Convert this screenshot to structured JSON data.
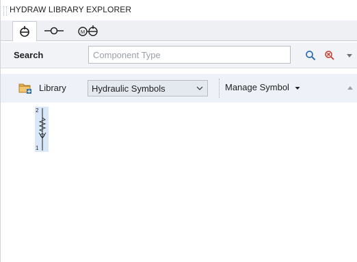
{
  "window": {
    "title": "HYDRAW LIBRARY EXPLORER"
  },
  "tabs": [
    {
      "icon": "component-icon",
      "active": true
    },
    {
      "icon": "connection-line-icon",
      "active": false
    },
    {
      "icon": "motor-pump-icon",
      "active": false
    }
  ],
  "search": {
    "label": "Search",
    "value": "",
    "placeholder": "Component Type",
    "find_icon": "magnifier-icon",
    "clear_icon": "clear-search-icon",
    "options_icon": "dropdown-arrow-icon"
  },
  "library": {
    "label": "Library",
    "icon": "library-folder-icon",
    "selected": "Hydraulic Symbols",
    "manage_label": "Manage Symbol",
    "collapse_icon": "collapse-up-icon"
  },
  "symbols": [
    {
      "name": "spring-check-valve-symbol",
      "pin_top": "2",
      "pin_bottom": "1"
    }
  ],
  "colors": {
    "accent": "#2e6db4",
    "toolbar_bg": "#eef2f8",
    "selection_bg": "#d9e8f8"
  }
}
